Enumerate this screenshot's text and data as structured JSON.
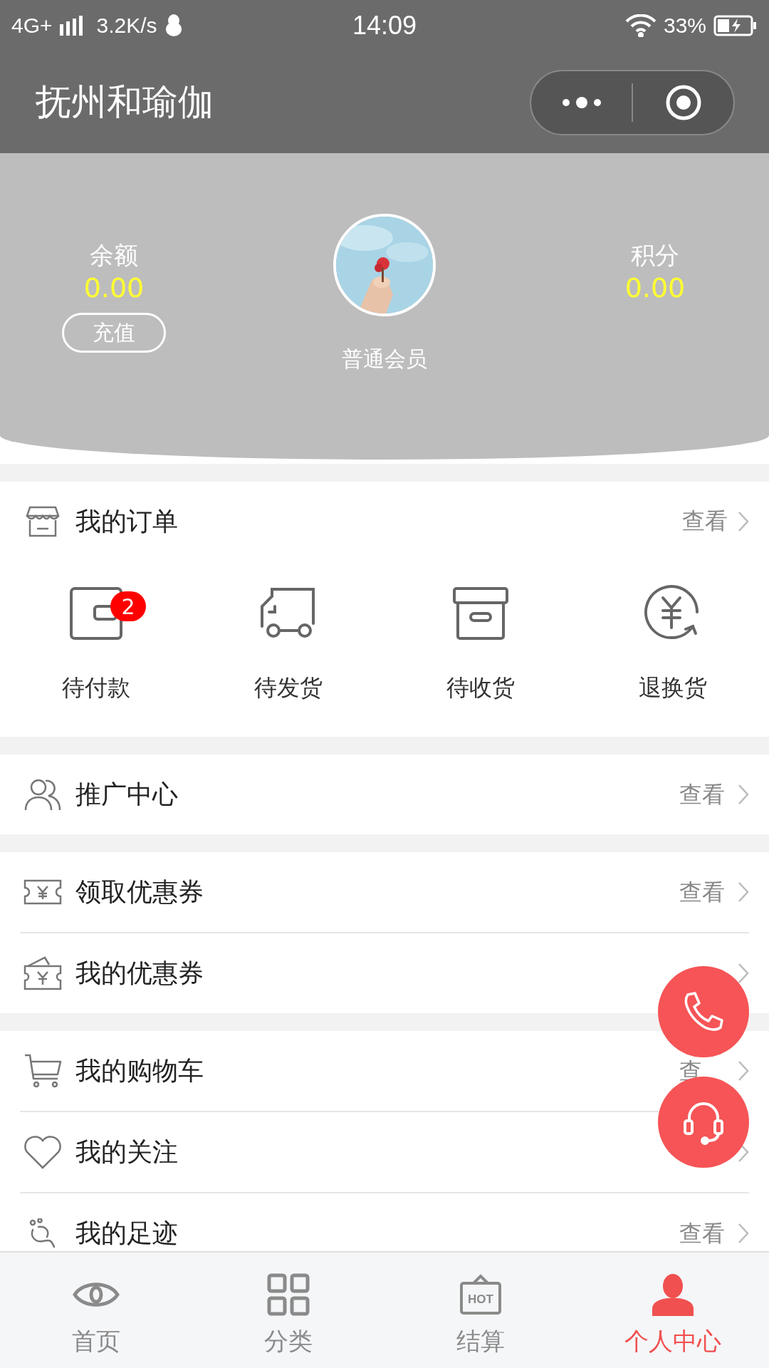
{
  "status_bar": {
    "network": "4G+",
    "speed": "3.2K/s",
    "time": "14:09",
    "battery": "33%"
  },
  "nav": {
    "title": "抚州和瑜伽"
  },
  "profile": {
    "balance_label": "余额",
    "balance_value": "0.00",
    "recharge_button": "充值",
    "member_level": "普通会员",
    "points_label": "积分",
    "points_value": "0.00"
  },
  "orders": {
    "title": "我的订单",
    "link": "查看",
    "items": [
      {
        "kind": "wallet",
        "label": "待付款",
        "badge": "2"
      },
      {
        "kind": "truck",
        "label": "待发货"
      },
      {
        "kind": "box",
        "label": "待收货"
      },
      {
        "kind": "refund",
        "label": "退换货"
      }
    ]
  },
  "menu_groups": [
    [
      {
        "kind": "team",
        "label": "推广中心",
        "link": "查看"
      }
    ],
    [
      {
        "kind": "ticket",
        "label": "领取优惠券",
        "link": "查看"
      },
      {
        "kind": "wallet",
        "label": "我的优惠券"
      }
    ],
    [
      {
        "kind": "cart",
        "label": "我的购物车",
        "link": "查"
      },
      {
        "kind": "heart",
        "label": "我的关注"
      },
      {
        "kind": "footprint",
        "label": "我的足迹",
        "link": "查看"
      }
    ]
  ],
  "floating_buttons": [
    {
      "kind": "phone"
    },
    {
      "kind": "headset"
    }
  ],
  "tabs": [
    {
      "kind": "eye",
      "label": "首页",
      "selected": false
    },
    {
      "kind": "grid",
      "label": "分类",
      "selected": false
    },
    {
      "kind": "hot",
      "label": "结算",
      "selected": false,
      "icon_text": "HOT"
    },
    {
      "kind": "person",
      "label": "个人中心",
      "selected": true
    }
  ]
}
